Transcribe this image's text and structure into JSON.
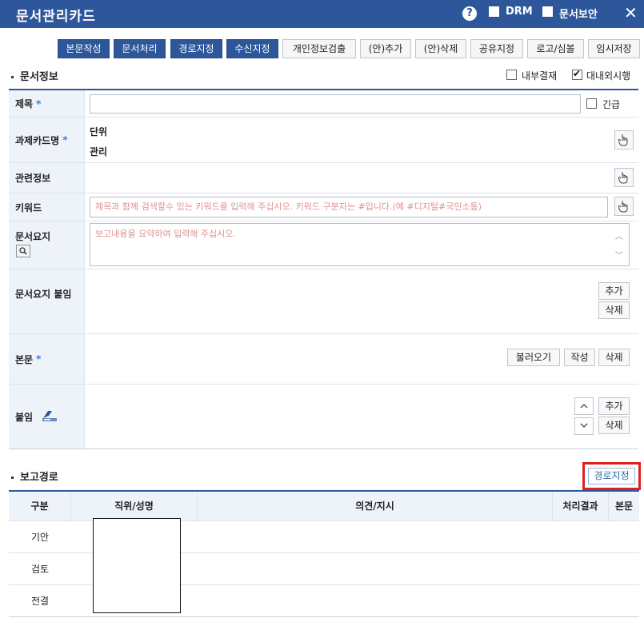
{
  "titlebar": {
    "title": "문서관리카드",
    "help_glyph": "?",
    "drm_label": "DRM",
    "security_label": "문서보안",
    "close_glyph": "✕"
  },
  "toolbar": {
    "buttons": [
      "본문작성",
      "문서처리",
      "경로지정",
      "수신지정",
      "개인정보검출",
      "(안)추가",
      "(안)삭제",
      "공유지정",
      "로고/심볼",
      "임시저장"
    ]
  },
  "doc_info": {
    "heading": "문서정보",
    "internal_approval_label": "내부결재",
    "internal_approval_checked": false,
    "external_enforce_label": "대내외시행",
    "external_enforce_checked": true
  },
  "fields": {
    "title_label": "제목",
    "title_value": "",
    "urgent_label": "긴급",
    "task_card_label": "과제카드명",
    "task_card_line1": "단위",
    "task_card_line2": "관리",
    "related_label": "관련정보",
    "keyword_label": "키워드",
    "keyword_placeholder": "제목과 함께 검색할수 있는 키워드를 입력해 주십시오. 키워드 구분자는 #입니다.(예 #디지털#국민소통)",
    "summary_label": "문서요지",
    "summary_placeholder": "보고내용을 요약하여 입력해 주십시오.",
    "summary_attach_label": "문서요지 붙임",
    "body_label": "본문",
    "attach_label": "붙임",
    "required_mark": "*",
    "add_label": "추가",
    "delete_label": "삭제",
    "load_label": "불러오기",
    "write_label": "작성"
  },
  "route": {
    "heading": "보고경로",
    "route_button": "경로지정",
    "columns": [
      "구분",
      "직위/성명",
      "의견/지시",
      "처리결과",
      "본문"
    ],
    "rows": [
      "기안",
      "검토",
      "전결"
    ]
  }
}
